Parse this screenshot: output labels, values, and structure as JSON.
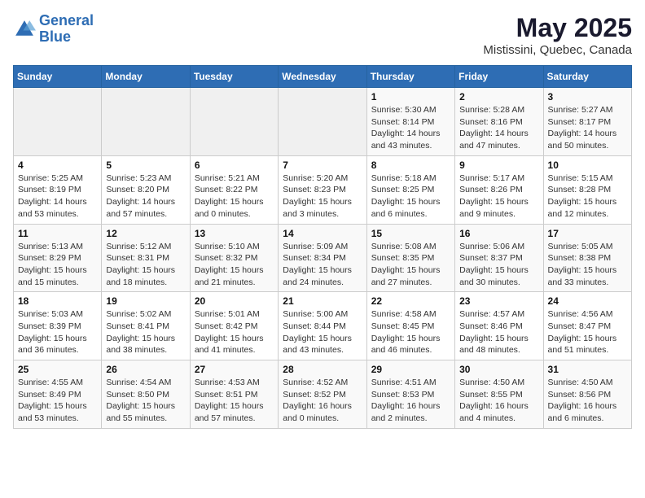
{
  "logo": {
    "line1": "General",
    "line2": "Blue"
  },
  "title": "May 2025",
  "subtitle": "Mistissini, Quebec, Canada",
  "days_of_week": [
    "Sunday",
    "Monday",
    "Tuesday",
    "Wednesday",
    "Thursday",
    "Friday",
    "Saturday"
  ],
  "weeks": [
    [
      {
        "day": "",
        "info": ""
      },
      {
        "day": "",
        "info": ""
      },
      {
        "day": "",
        "info": ""
      },
      {
        "day": "",
        "info": ""
      },
      {
        "day": "1",
        "info": "Sunrise: 5:30 AM\nSunset: 8:14 PM\nDaylight: 14 hours\nand 43 minutes."
      },
      {
        "day": "2",
        "info": "Sunrise: 5:28 AM\nSunset: 8:16 PM\nDaylight: 14 hours\nand 47 minutes."
      },
      {
        "day": "3",
        "info": "Sunrise: 5:27 AM\nSunset: 8:17 PM\nDaylight: 14 hours\nand 50 minutes."
      }
    ],
    [
      {
        "day": "4",
        "info": "Sunrise: 5:25 AM\nSunset: 8:19 PM\nDaylight: 14 hours\nand 53 minutes."
      },
      {
        "day": "5",
        "info": "Sunrise: 5:23 AM\nSunset: 8:20 PM\nDaylight: 14 hours\nand 57 minutes."
      },
      {
        "day": "6",
        "info": "Sunrise: 5:21 AM\nSunset: 8:22 PM\nDaylight: 15 hours\nand 0 minutes."
      },
      {
        "day": "7",
        "info": "Sunrise: 5:20 AM\nSunset: 8:23 PM\nDaylight: 15 hours\nand 3 minutes."
      },
      {
        "day": "8",
        "info": "Sunrise: 5:18 AM\nSunset: 8:25 PM\nDaylight: 15 hours\nand 6 minutes."
      },
      {
        "day": "9",
        "info": "Sunrise: 5:17 AM\nSunset: 8:26 PM\nDaylight: 15 hours\nand 9 minutes."
      },
      {
        "day": "10",
        "info": "Sunrise: 5:15 AM\nSunset: 8:28 PM\nDaylight: 15 hours\nand 12 minutes."
      }
    ],
    [
      {
        "day": "11",
        "info": "Sunrise: 5:13 AM\nSunset: 8:29 PM\nDaylight: 15 hours\nand 15 minutes."
      },
      {
        "day": "12",
        "info": "Sunrise: 5:12 AM\nSunset: 8:31 PM\nDaylight: 15 hours\nand 18 minutes."
      },
      {
        "day": "13",
        "info": "Sunrise: 5:10 AM\nSunset: 8:32 PM\nDaylight: 15 hours\nand 21 minutes."
      },
      {
        "day": "14",
        "info": "Sunrise: 5:09 AM\nSunset: 8:34 PM\nDaylight: 15 hours\nand 24 minutes."
      },
      {
        "day": "15",
        "info": "Sunrise: 5:08 AM\nSunset: 8:35 PM\nDaylight: 15 hours\nand 27 minutes."
      },
      {
        "day": "16",
        "info": "Sunrise: 5:06 AM\nSunset: 8:37 PM\nDaylight: 15 hours\nand 30 minutes."
      },
      {
        "day": "17",
        "info": "Sunrise: 5:05 AM\nSunset: 8:38 PM\nDaylight: 15 hours\nand 33 minutes."
      }
    ],
    [
      {
        "day": "18",
        "info": "Sunrise: 5:03 AM\nSunset: 8:39 PM\nDaylight: 15 hours\nand 36 minutes."
      },
      {
        "day": "19",
        "info": "Sunrise: 5:02 AM\nSunset: 8:41 PM\nDaylight: 15 hours\nand 38 minutes."
      },
      {
        "day": "20",
        "info": "Sunrise: 5:01 AM\nSunset: 8:42 PM\nDaylight: 15 hours\nand 41 minutes."
      },
      {
        "day": "21",
        "info": "Sunrise: 5:00 AM\nSunset: 8:44 PM\nDaylight: 15 hours\nand 43 minutes."
      },
      {
        "day": "22",
        "info": "Sunrise: 4:58 AM\nSunset: 8:45 PM\nDaylight: 15 hours\nand 46 minutes."
      },
      {
        "day": "23",
        "info": "Sunrise: 4:57 AM\nSunset: 8:46 PM\nDaylight: 15 hours\nand 48 minutes."
      },
      {
        "day": "24",
        "info": "Sunrise: 4:56 AM\nSunset: 8:47 PM\nDaylight: 15 hours\nand 51 minutes."
      }
    ],
    [
      {
        "day": "25",
        "info": "Sunrise: 4:55 AM\nSunset: 8:49 PM\nDaylight: 15 hours\nand 53 minutes."
      },
      {
        "day": "26",
        "info": "Sunrise: 4:54 AM\nSunset: 8:50 PM\nDaylight: 15 hours\nand 55 minutes."
      },
      {
        "day": "27",
        "info": "Sunrise: 4:53 AM\nSunset: 8:51 PM\nDaylight: 15 hours\nand 57 minutes."
      },
      {
        "day": "28",
        "info": "Sunrise: 4:52 AM\nSunset: 8:52 PM\nDaylight: 16 hours\nand 0 minutes."
      },
      {
        "day": "29",
        "info": "Sunrise: 4:51 AM\nSunset: 8:53 PM\nDaylight: 16 hours\nand 2 minutes."
      },
      {
        "day": "30",
        "info": "Sunrise: 4:50 AM\nSunset: 8:55 PM\nDaylight: 16 hours\nand 4 minutes."
      },
      {
        "day": "31",
        "info": "Sunrise: 4:50 AM\nSunset: 8:56 PM\nDaylight: 16 hours\nand 6 minutes."
      }
    ]
  ]
}
